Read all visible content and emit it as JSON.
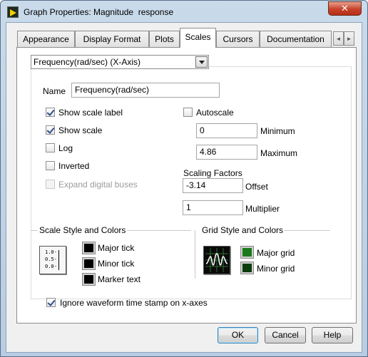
{
  "window": {
    "title": "Graph Properties: Magnitude  response",
    "close_label": "✕"
  },
  "tabs": [
    {
      "label": "Appearance",
      "active": false
    },
    {
      "label": "Display Format",
      "active": false
    },
    {
      "label": "Plots",
      "active": false
    },
    {
      "label": "Scales",
      "active": true
    },
    {
      "label": "Cursors",
      "active": false
    },
    {
      "label": "Documentation",
      "active": false
    }
  ],
  "tab_scroll": {
    "left": "◄",
    "right": "►"
  },
  "scales": {
    "axis_select": "Frequency(rad/sec) (X-Axis)",
    "name_label": "Name",
    "name_value": "Frequency(rad/sec)",
    "show_scale_label": {
      "label": "Show scale label",
      "checked": true
    },
    "show_scale": {
      "label": "Show scale",
      "checked": true
    },
    "log": {
      "label": "Log",
      "checked": false
    },
    "inverted": {
      "label": "Inverted",
      "checked": false
    },
    "expand_digital_buses": {
      "label": "Expand digital buses",
      "checked": false,
      "disabled": true
    },
    "autoscale": {
      "label": "Autoscale",
      "checked": false
    },
    "minimum_value": "0",
    "minimum_label": "Minimum",
    "maximum_value": "4.86",
    "maximum_label": "Maximum",
    "scaling_factors_title": "Scaling Factors",
    "offset_value": "-3.14",
    "offset_label": "Offset",
    "multiplier_value": "1",
    "multiplier_label": "Multiplier"
  },
  "scale_style": {
    "title": "Scale Style and Colors",
    "icon_ticks": [
      "1.0-",
      "0.5-",
      "0.0-"
    ],
    "major_tick": "Major tick",
    "minor_tick": "Minor tick",
    "marker_text": "Marker text",
    "major_tick_color": "#000000",
    "minor_tick_color": "#000000",
    "marker_text_color": "#000000"
  },
  "grid_style": {
    "title": "Grid Style and Colors",
    "major_grid": "Major grid",
    "minor_grid": "Minor grid",
    "major_grid_color": "#1a7a1a",
    "minor_grid_color": "#0b3d0b"
  },
  "ignore_timestamp": {
    "label": "Ignore waveform time stamp on x-axes",
    "checked": true
  },
  "buttons": {
    "ok": "OK",
    "cancel": "Cancel",
    "help": "Help"
  }
}
